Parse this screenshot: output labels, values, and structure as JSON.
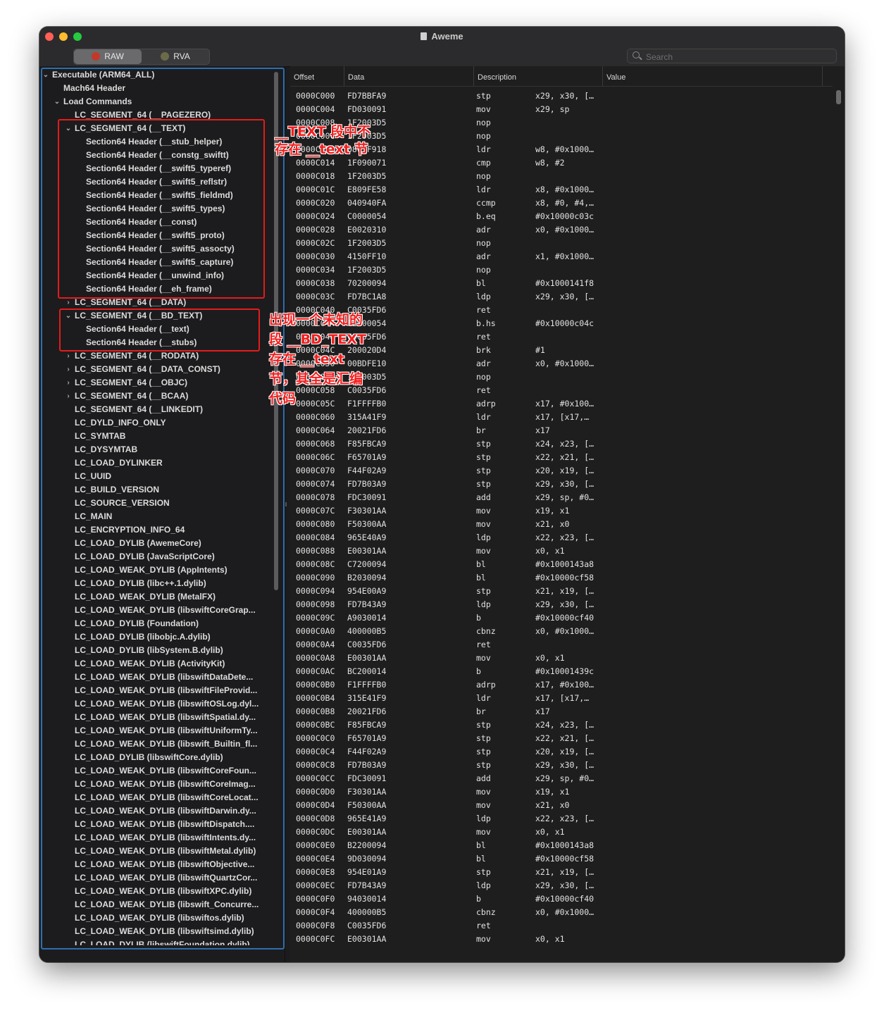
{
  "window": {
    "title": "Aweme"
  },
  "toolbar": {
    "mode_buttons": [
      {
        "label": "RAW",
        "active": true
      },
      {
        "label": "RVA",
        "active": false
      }
    ],
    "search_placeholder": "Search"
  },
  "tree": [
    {
      "label": "Executable  (ARM64_ALL)",
      "level": 0,
      "chevron": "down"
    },
    {
      "label": "Mach64 Header",
      "level": 1,
      "chevron": ""
    },
    {
      "label": "Load Commands",
      "level": 1,
      "chevron": "down"
    },
    {
      "label": "LC_SEGMENT_64 (__PAGEZERO)",
      "level": 2,
      "chevron": ""
    },
    {
      "label": "LC_SEGMENT_64 (__TEXT)",
      "level": 2,
      "chevron": "down"
    },
    {
      "label": "Section64 Header (__stub_helper)",
      "level": 3,
      "chevron": ""
    },
    {
      "label": "Section64 Header (__constg_swiftt)",
      "level": 3,
      "chevron": ""
    },
    {
      "label": "Section64 Header (__swift5_typeref)",
      "level": 3,
      "chevron": ""
    },
    {
      "label": "Section64 Header (__swift5_reflstr)",
      "level": 3,
      "chevron": ""
    },
    {
      "label": "Section64 Header (__swift5_fieldmd)",
      "level": 3,
      "chevron": ""
    },
    {
      "label": "Section64 Header (__swift5_types)",
      "level": 3,
      "chevron": ""
    },
    {
      "label": "Section64 Header (__const)",
      "level": 3,
      "chevron": ""
    },
    {
      "label": "Section64 Header (__swift5_proto)",
      "level": 3,
      "chevron": ""
    },
    {
      "label": "Section64 Header (__swift5_assocty)",
      "level": 3,
      "chevron": ""
    },
    {
      "label": "Section64 Header (__swift5_capture)",
      "level": 3,
      "chevron": ""
    },
    {
      "label": "Section64 Header (__unwind_info)",
      "level": 3,
      "chevron": ""
    },
    {
      "label": "Section64 Header (__eh_frame)",
      "level": 3,
      "chevron": ""
    },
    {
      "label": "LC_SEGMENT_64 (__DATA)",
      "level": 2,
      "chevron": "right"
    },
    {
      "label": "LC_SEGMENT_64 (__BD_TEXT)",
      "level": 2,
      "chevron": "down"
    },
    {
      "label": "Section64 Header (__text)",
      "level": 3,
      "chevron": ""
    },
    {
      "label": "Section64 Header (__stubs)",
      "level": 3,
      "chevron": ""
    },
    {
      "label": "LC_SEGMENT_64 (__RODATA)",
      "level": 2,
      "chevron": "right"
    },
    {
      "label": "LC_SEGMENT_64 (__DATA_CONST)",
      "level": 2,
      "chevron": "right"
    },
    {
      "label": "LC_SEGMENT_64 (__OBJC)",
      "level": 2,
      "chevron": "right"
    },
    {
      "label": "LC_SEGMENT_64 (__BCAA)",
      "level": 2,
      "chevron": "right"
    },
    {
      "label": "LC_SEGMENT_64 (__LINKEDIT)",
      "level": 2,
      "chevron": ""
    },
    {
      "label": "LC_DYLD_INFO_ONLY",
      "level": 2,
      "chevron": ""
    },
    {
      "label": "LC_SYMTAB",
      "level": 2,
      "chevron": ""
    },
    {
      "label": "LC_DYSYMTAB",
      "level": 2,
      "chevron": ""
    },
    {
      "label": "LC_LOAD_DYLINKER",
      "level": 2,
      "chevron": ""
    },
    {
      "label": "LC_UUID",
      "level": 2,
      "chevron": ""
    },
    {
      "label": "LC_BUILD_VERSION",
      "level": 2,
      "chevron": ""
    },
    {
      "label": "LC_SOURCE_VERSION",
      "level": 2,
      "chevron": ""
    },
    {
      "label": "LC_MAIN",
      "level": 2,
      "chevron": ""
    },
    {
      "label": "LC_ENCRYPTION_INFO_64",
      "level": 2,
      "chevron": ""
    },
    {
      "label": "LC_LOAD_DYLIB (AwemeCore)",
      "level": 2,
      "chevron": ""
    },
    {
      "label": "LC_LOAD_DYLIB (JavaScriptCore)",
      "level": 2,
      "chevron": ""
    },
    {
      "label": "LC_LOAD_WEAK_DYLIB (AppIntents)",
      "level": 2,
      "chevron": ""
    },
    {
      "label": "LC_LOAD_DYLIB (libc++.1.dylib)",
      "level": 2,
      "chevron": ""
    },
    {
      "label": "LC_LOAD_WEAK_DYLIB (MetalFX)",
      "level": 2,
      "chevron": ""
    },
    {
      "label": "LC_LOAD_WEAK_DYLIB (libswiftCoreGrap...",
      "level": 2,
      "chevron": ""
    },
    {
      "label": "LC_LOAD_DYLIB (Foundation)",
      "level": 2,
      "chevron": ""
    },
    {
      "label": "LC_LOAD_DYLIB (libobjc.A.dylib)",
      "level": 2,
      "chevron": ""
    },
    {
      "label": "LC_LOAD_DYLIB (libSystem.B.dylib)",
      "level": 2,
      "chevron": ""
    },
    {
      "label": "LC_LOAD_WEAK_DYLIB (ActivityKit)",
      "level": 2,
      "chevron": ""
    },
    {
      "label": "LC_LOAD_WEAK_DYLIB (libswiftDataDete...",
      "level": 2,
      "chevron": ""
    },
    {
      "label": "LC_LOAD_WEAK_DYLIB (libswiftFileProvid...",
      "level": 2,
      "chevron": ""
    },
    {
      "label": "LC_LOAD_WEAK_DYLIB (libswiftOSLog.dyl...",
      "level": 2,
      "chevron": ""
    },
    {
      "label": "LC_LOAD_WEAK_DYLIB (libswiftSpatial.dy...",
      "level": 2,
      "chevron": ""
    },
    {
      "label": "LC_LOAD_WEAK_DYLIB (libswiftUniformTy...",
      "level": 2,
      "chevron": ""
    },
    {
      "label": "LC_LOAD_WEAK_DYLIB (libswift_Builtin_fl...",
      "level": 2,
      "chevron": ""
    },
    {
      "label": "LC_LOAD_DYLIB (libswiftCore.dylib)",
      "level": 2,
      "chevron": ""
    },
    {
      "label": "LC_LOAD_WEAK_DYLIB (libswiftCoreFoun...",
      "level": 2,
      "chevron": ""
    },
    {
      "label": "LC_LOAD_WEAK_DYLIB (libswiftCoreImag...",
      "level": 2,
      "chevron": ""
    },
    {
      "label": "LC_LOAD_WEAK_DYLIB (libswiftCoreLocat...",
      "level": 2,
      "chevron": ""
    },
    {
      "label": "LC_LOAD_WEAK_DYLIB (libswiftDarwin.dy...",
      "level": 2,
      "chevron": ""
    },
    {
      "label": "LC_LOAD_WEAK_DYLIB (libswiftDispatch....",
      "level": 2,
      "chevron": ""
    },
    {
      "label": "LC_LOAD_WEAK_DYLIB (libswiftIntents.dy...",
      "level": 2,
      "chevron": ""
    },
    {
      "label": "LC_LOAD_WEAK_DYLIB (libswiftMetal.dylib)",
      "level": 2,
      "chevron": ""
    },
    {
      "label": "LC_LOAD_WEAK_DYLIB (libswiftObjective...",
      "level": 2,
      "chevron": ""
    },
    {
      "label": "LC_LOAD_WEAK_DYLIB (libswiftQuartzCor...",
      "level": 2,
      "chevron": ""
    },
    {
      "label": "LC_LOAD_WEAK_DYLIB (libswiftXPC.dylib)",
      "level": 2,
      "chevron": ""
    },
    {
      "label": "LC_LOAD_WEAK_DYLIB (libswift_Concurre...",
      "level": 2,
      "chevron": ""
    },
    {
      "label": "LC_LOAD_WEAK_DYLIB (libswiftos.dylib)",
      "level": 2,
      "chevron": ""
    },
    {
      "label": "LC_LOAD_WEAK_DYLIB (libswiftsimd.dylib)",
      "level": 2,
      "chevron": ""
    },
    {
      "label": "LC_LOAD_DYLIB (libswiftFoundation.dylib)",
      "level": 2,
      "chevron": ""
    }
  ],
  "table": {
    "columns": [
      "Offset",
      "Data",
      "Description",
      "Value"
    ],
    "rows": [
      [
        "0000C000",
        "FD7BBFA9",
        "stp",
        "x29, x30, […"
      ],
      [
        "0000C004",
        "FD030091",
        "mov",
        "x29, sp"
      ],
      [
        "0000C008",
        "1F2003D5",
        "nop",
        ""
      ],
      [
        "0000C00C",
        "1F2003D5",
        "nop",
        ""
      ],
      [
        "0000C010",
        "0807F918",
        "ldr",
        "w8, #0x1000…"
      ],
      [
        "0000C014",
        "1F090071",
        "cmp",
        "w8, #2"
      ],
      [
        "0000C018",
        "1F2003D5",
        "nop",
        ""
      ],
      [
        "0000C01C",
        "E809FE58",
        "ldr",
        "x8, #0x1000…"
      ],
      [
        "0000C020",
        "040940FA",
        "ccmp",
        "x8, #0, #4,…"
      ],
      [
        "0000C024",
        "C0000054",
        "b.eq",
        "#0x10000c03c"
      ],
      [
        "0000C028",
        "E0020310",
        "adr",
        "x0, #0x1000…"
      ],
      [
        "0000C02C",
        "1F2003D5",
        "nop",
        ""
      ],
      [
        "0000C030",
        "4150FF10",
        "adr",
        "x1, #0x1000…"
      ],
      [
        "0000C034",
        "1F2003D5",
        "nop",
        ""
      ],
      [
        "0000C038",
        "70200094",
        "bl",
        "#0x1000141f8"
      ],
      [
        "0000C03C",
        "FD7BC1A8",
        "ldp",
        "x29, x30, […"
      ],
      [
        "0000C040",
        "C0035FD6",
        "ret",
        ""
      ],
      [
        "0000C044",
        "62000054",
        "b.hs",
        "#0x10000c04c"
      ],
      [
        "0000C048",
        "C0035FD6",
        "ret",
        ""
      ],
      [
        "0000C04C",
        "200020D4",
        "brk",
        "#1"
      ],
      [
        "0000C050",
        "00BDFE10",
        "adr",
        "x0, #0x1000…"
      ],
      [
        "0000C054",
        "1F2003D5",
        "nop",
        ""
      ],
      [
        "0000C058",
        "C0035FD6",
        "ret",
        ""
      ],
      [
        "0000C05C",
        "F1FFFFB0",
        "adrp",
        "x17, #0x100…"
      ],
      [
        "0000C060",
        "315A41F9",
        "ldr",
        "x17, [x17,…"
      ],
      [
        "0000C064",
        "20021FD6",
        "br",
        "x17"
      ],
      [
        "0000C068",
        "F85FBCA9",
        "stp",
        "x24, x23, […"
      ],
      [
        "0000C06C",
        "F65701A9",
        "stp",
        "x22, x21, […"
      ],
      [
        "0000C070",
        "F44F02A9",
        "stp",
        "x20, x19, […"
      ],
      [
        "0000C074",
        "FD7B03A9",
        "stp",
        "x29, x30, […"
      ],
      [
        "0000C078",
        "FDC30091",
        "add",
        "x29, sp, #0…"
      ],
      [
        "0000C07C",
        "F30301AA",
        "mov",
        "x19, x1"
      ],
      [
        "0000C080",
        "F50300AA",
        "mov",
        "x21, x0"
      ],
      [
        "0000C084",
        "965E40A9",
        "ldp",
        "x22, x23, […"
      ],
      [
        "0000C088",
        "E00301AA",
        "mov",
        "x0, x1"
      ],
      [
        "0000C08C",
        "C7200094",
        "bl",
        "#0x1000143a8"
      ],
      [
        "0000C090",
        "B2030094",
        "bl",
        "#0x10000cf58"
      ],
      [
        "0000C094",
        "954E00A9",
        "stp",
        "x21, x19, […"
      ],
      [
        "0000C098",
        "FD7B43A9",
        "ldp",
        "x29, x30, […"
      ],
      [
        "0000C09C",
        "A9030014",
        "b",
        "#0x10000cf40"
      ],
      [
        "0000C0A0",
        "400000B5",
        "cbnz",
        "x0, #0x1000…"
      ],
      [
        "0000C0A4",
        "C0035FD6",
        "ret",
        ""
      ],
      [
        "0000C0A8",
        "E00301AA",
        "mov",
        "x0, x1"
      ],
      [
        "0000C0AC",
        "BC200014",
        "b",
        "#0x10001439c"
      ],
      [
        "0000C0B0",
        "F1FFFFB0",
        "adrp",
        "x17, #0x100…"
      ],
      [
        "0000C0B4",
        "315E41F9",
        "ldr",
        "x17, [x17,…"
      ],
      [
        "0000C0B8",
        "20021FD6",
        "br",
        "x17"
      ],
      [
        "0000C0BC",
        "F85FBCA9",
        "stp",
        "x24, x23, […"
      ],
      [
        "0000C0C0",
        "F65701A9",
        "stp",
        "x22, x21, […"
      ],
      [
        "0000C0C4",
        "F44F02A9",
        "stp",
        "x20, x19, […"
      ],
      [
        "0000C0C8",
        "FD7B03A9",
        "stp",
        "x29, x30, […"
      ],
      [
        "0000C0CC",
        "FDC30091",
        "add",
        "x29, sp, #0…"
      ],
      [
        "0000C0D0",
        "F30301AA",
        "mov",
        "x19, x1"
      ],
      [
        "0000C0D4",
        "F50300AA",
        "mov",
        "x21, x0"
      ],
      [
        "0000C0D8",
        "965E41A9",
        "ldp",
        "x22, x23, […"
      ],
      [
        "0000C0DC",
        "E00301AA",
        "mov",
        "x0, x1"
      ],
      [
        "0000C0E0",
        "B2200094",
        "bl",
        "#0x1000143a8"
      ],
      [
        "0000C0E4",
        "9D030094",
        "bl",
        "#0x10000cf58"
      ],
      [
        "0000C0E8",
        "954E01A9",
        "stp",
        "x21, x19, […"
      ],
      [
        "0000C0EC",
        "FD7B43A9",
        "ldp",
        "x29, x30, […"
      ],
      [
        "0000C0F0",
        "94030014",
        "b",
        "#0x10000cf40"
      ],
      [
        "0000C0F4",
        "400000B5",
        "cbnz",
        "x0, #0x1000…"
      ],
      [
        "0000C0F8",
        "C0035FD6",
        "ret",
        ""
      ],
      [
        "0000C0FC",
        "E00301AA",
        "mov",
        "x0, x1"
      ]
    ]
  },
  "annotations": {
    "text_segment_note": [
      "__TEXT 段中不",
      "存在 __text 节"
    ],
    "bd_text_note": [
      "出现一个未知的",
      "段 __BD_TEXT",
      "存在 __text",
      "节，其全是汇编",
      "代码"
    ],
    "color": "#e51b1b"
  }
}
